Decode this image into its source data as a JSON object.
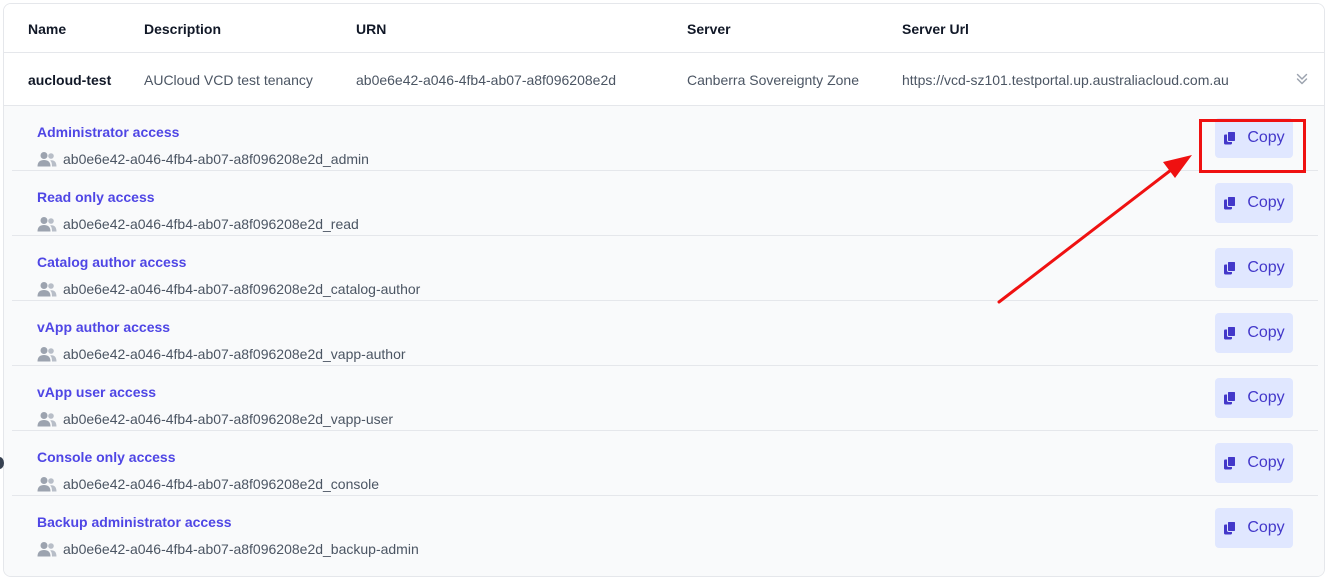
{
  "table": {
    "headers": [
      "Name",
      "Description",
      "URN",
      "Server",
      "Server Url"
    ],
    "row": {
      "name": "aucloud-test",
      "description": "AUCloud VCD test tenancy",
      "urn": "ab0e6e42-a046-4fb4-ab07-a8f096208e2d",
      "server": "Canberra Sovereignty Zone",
      "server_url": "https://vcd-sz101.testportal.up.australiacloud.com.au"
    }
  },
  "access_items": [
    {
      "title": "Administrator access",
      "urn": "ab0e6e42-a046-4fb4-ab07-a8f096208e2d_admin",
      "copy_label": "Copy"
    },
    {
      "title": "Read only access",
      "urn": "ab0e6e42-a046-4fb4-ab07-a8f096208e2d_read",
      "copy_label": "Copy"
    },
    {
      "title": "Catalog author access",
      "urn": "ab0e6e42-a046-4fb4-ab07-a8f096208e2d_catalog-author",
      "copy_label": "Copy"
    },
    {
      "title": "vApp author access",
      "urn": "ab0e6e42-a046-4fb4-ab07-a8f096208e2d_vapp-author",
      "copy_label": "Copy"
    },
    {
      "title": "vApp user access",
      "urn": "ab0e6e42-a046-4fb4-ab07-a8f096208e2d_vapp-user",
      "copy_label": "Copy"
    },
    {
      "title": "Console only access",
      "urn": "ab0e6e42-a046-4fb4-ab07-a8f096208e2d_console",
      "copy_label": "Copy"
    },
    {
      "title": "Backup administrator access",
      "urn": "ab0e6e42-a046-4fb4-ab07-a8f096208e2d_backup-admin",
      "copy_label": "Copy"
    }
  ],
  "icons": {
    "group": "users-icon",
    "copy": "clipboard-icon",
    "expand": "chevron-double-down-icon"
  },
  "colors": {
    "accent": "#4f46e5",
    "button_bg": "#e0e7ff",
    "annotation": "#ef1111"
  }
}
